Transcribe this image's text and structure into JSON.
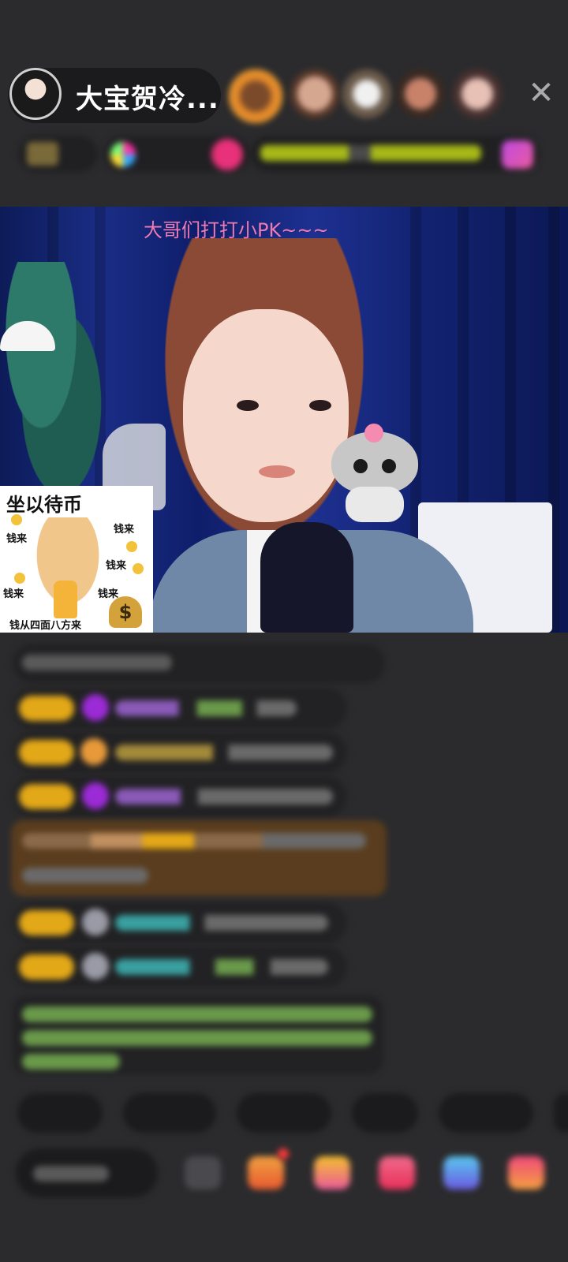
{
  "header": {
    "host_name": "大宝贺冷...",
    "close_symbol": "✕"
  },
  "video": {
    "caption": "大哥们打打小PK~~~"
  },
  "sticker": {
    "title": "坐以待币",
    "lines": [
      "钱来",
      "钱来",
      "钱来",
      "钱来",
      "钱来"
    ],
    "bottom": "钱从四面八方来",
    "dollar": "$"
  },
  "icons": {
    "close": "close-icon",
    "dollar": "dollar-bag-icon"
  },
  "colors": {
    "background": "#2b2b2d",
    "caption_pink": "#f07ab2",
    "badge_gold": "#e3a818",
    "gem_purple": "#9b2bd6"
  }
}
